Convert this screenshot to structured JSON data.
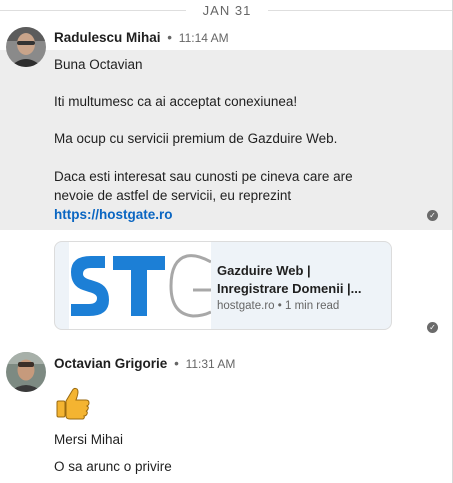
{
  "date_divider": "JAN 31",
  "messages": [
    {
      "sender": "Radulescu Mihai",
      "time": "11:14 AM",
      "lines": [
        "Buna Octavian",
        "Iti multumesc ca ai acceptat conexiunea!",
        "Ma ocup cu servicii premium de Gazduire Web.",
        "Daca esti interesat sau cunosti pe cineva care are",
        "nevoie de astfel de servicii, eu reprezint"
      ],
      "link": "https://hostgate.ro",
      "preview": {
        "title_line1": "Gazduire Web |",
        "title_line2": "Inregistrare Domenii |...",
        "domain": "hostgate.ro",
        "read_time": "1 min read",
        "thumb_text": "STG"
      }
    },
    {
      "sender": "Octavian Grigorie",
      "time": "11:31 AM",
      "emoji": "thumbs-up",
      "lines": [
        "Mersi Mihai",
        "O sa arunc o privire"
      ]
    }
  ],
  "separator": "•",
  "icons": [
    "read-receipt-icon",
    "thumbs-up-icon"
  ],
  "colors": {
    "link": "#0a66c2",
    "highlight": "#ededed",
    "card": "#eef3f8"
  }
}
